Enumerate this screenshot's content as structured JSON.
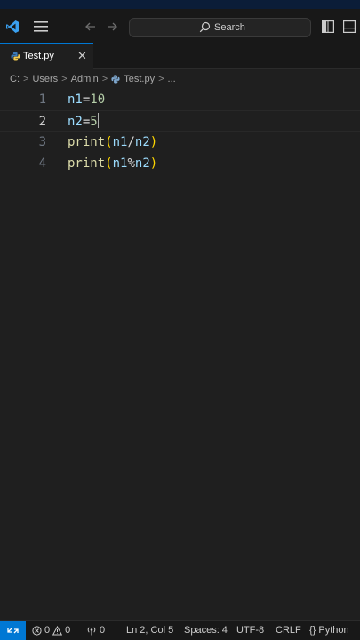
{
  "titlebar": {
    "search_label": "Search"
  },
  "tab": {
    "label": "Test.py",
    "close": "✕"
  },
  "breadcrumb": {
    "items": [
      "C:",
      "Users",
      "Admin",
      "Test.py",
      "..."
    ]
  },
  "editor": {
    "current_line": 2,
    "lines": [
      {
        "number": "1",
        "text": "n1=10"
      },
      {
        "number": "2",
        "text": "n2=5"
      },
      {
        "number": "3",
        "text": "print(n1/n2)"
      },
      {
        "number": "4",
        "text": "print(n1%n2)"
      }
    ]
  },
  "statusbar": {
    "errors": "0",
    "warnings": "0",
    "ports": "0",
    "position": "Ln 2, Col 5",
    "spaces": "Spaces: 4",
    "encoding": "UTF-8",
    "eol": "CRLF",
    "language": "Python"
  },
  "colors": {
    "accent": "#0078d4",
    "background": "#1f1f1f",
    "chrome": "#181818"
  }
}
